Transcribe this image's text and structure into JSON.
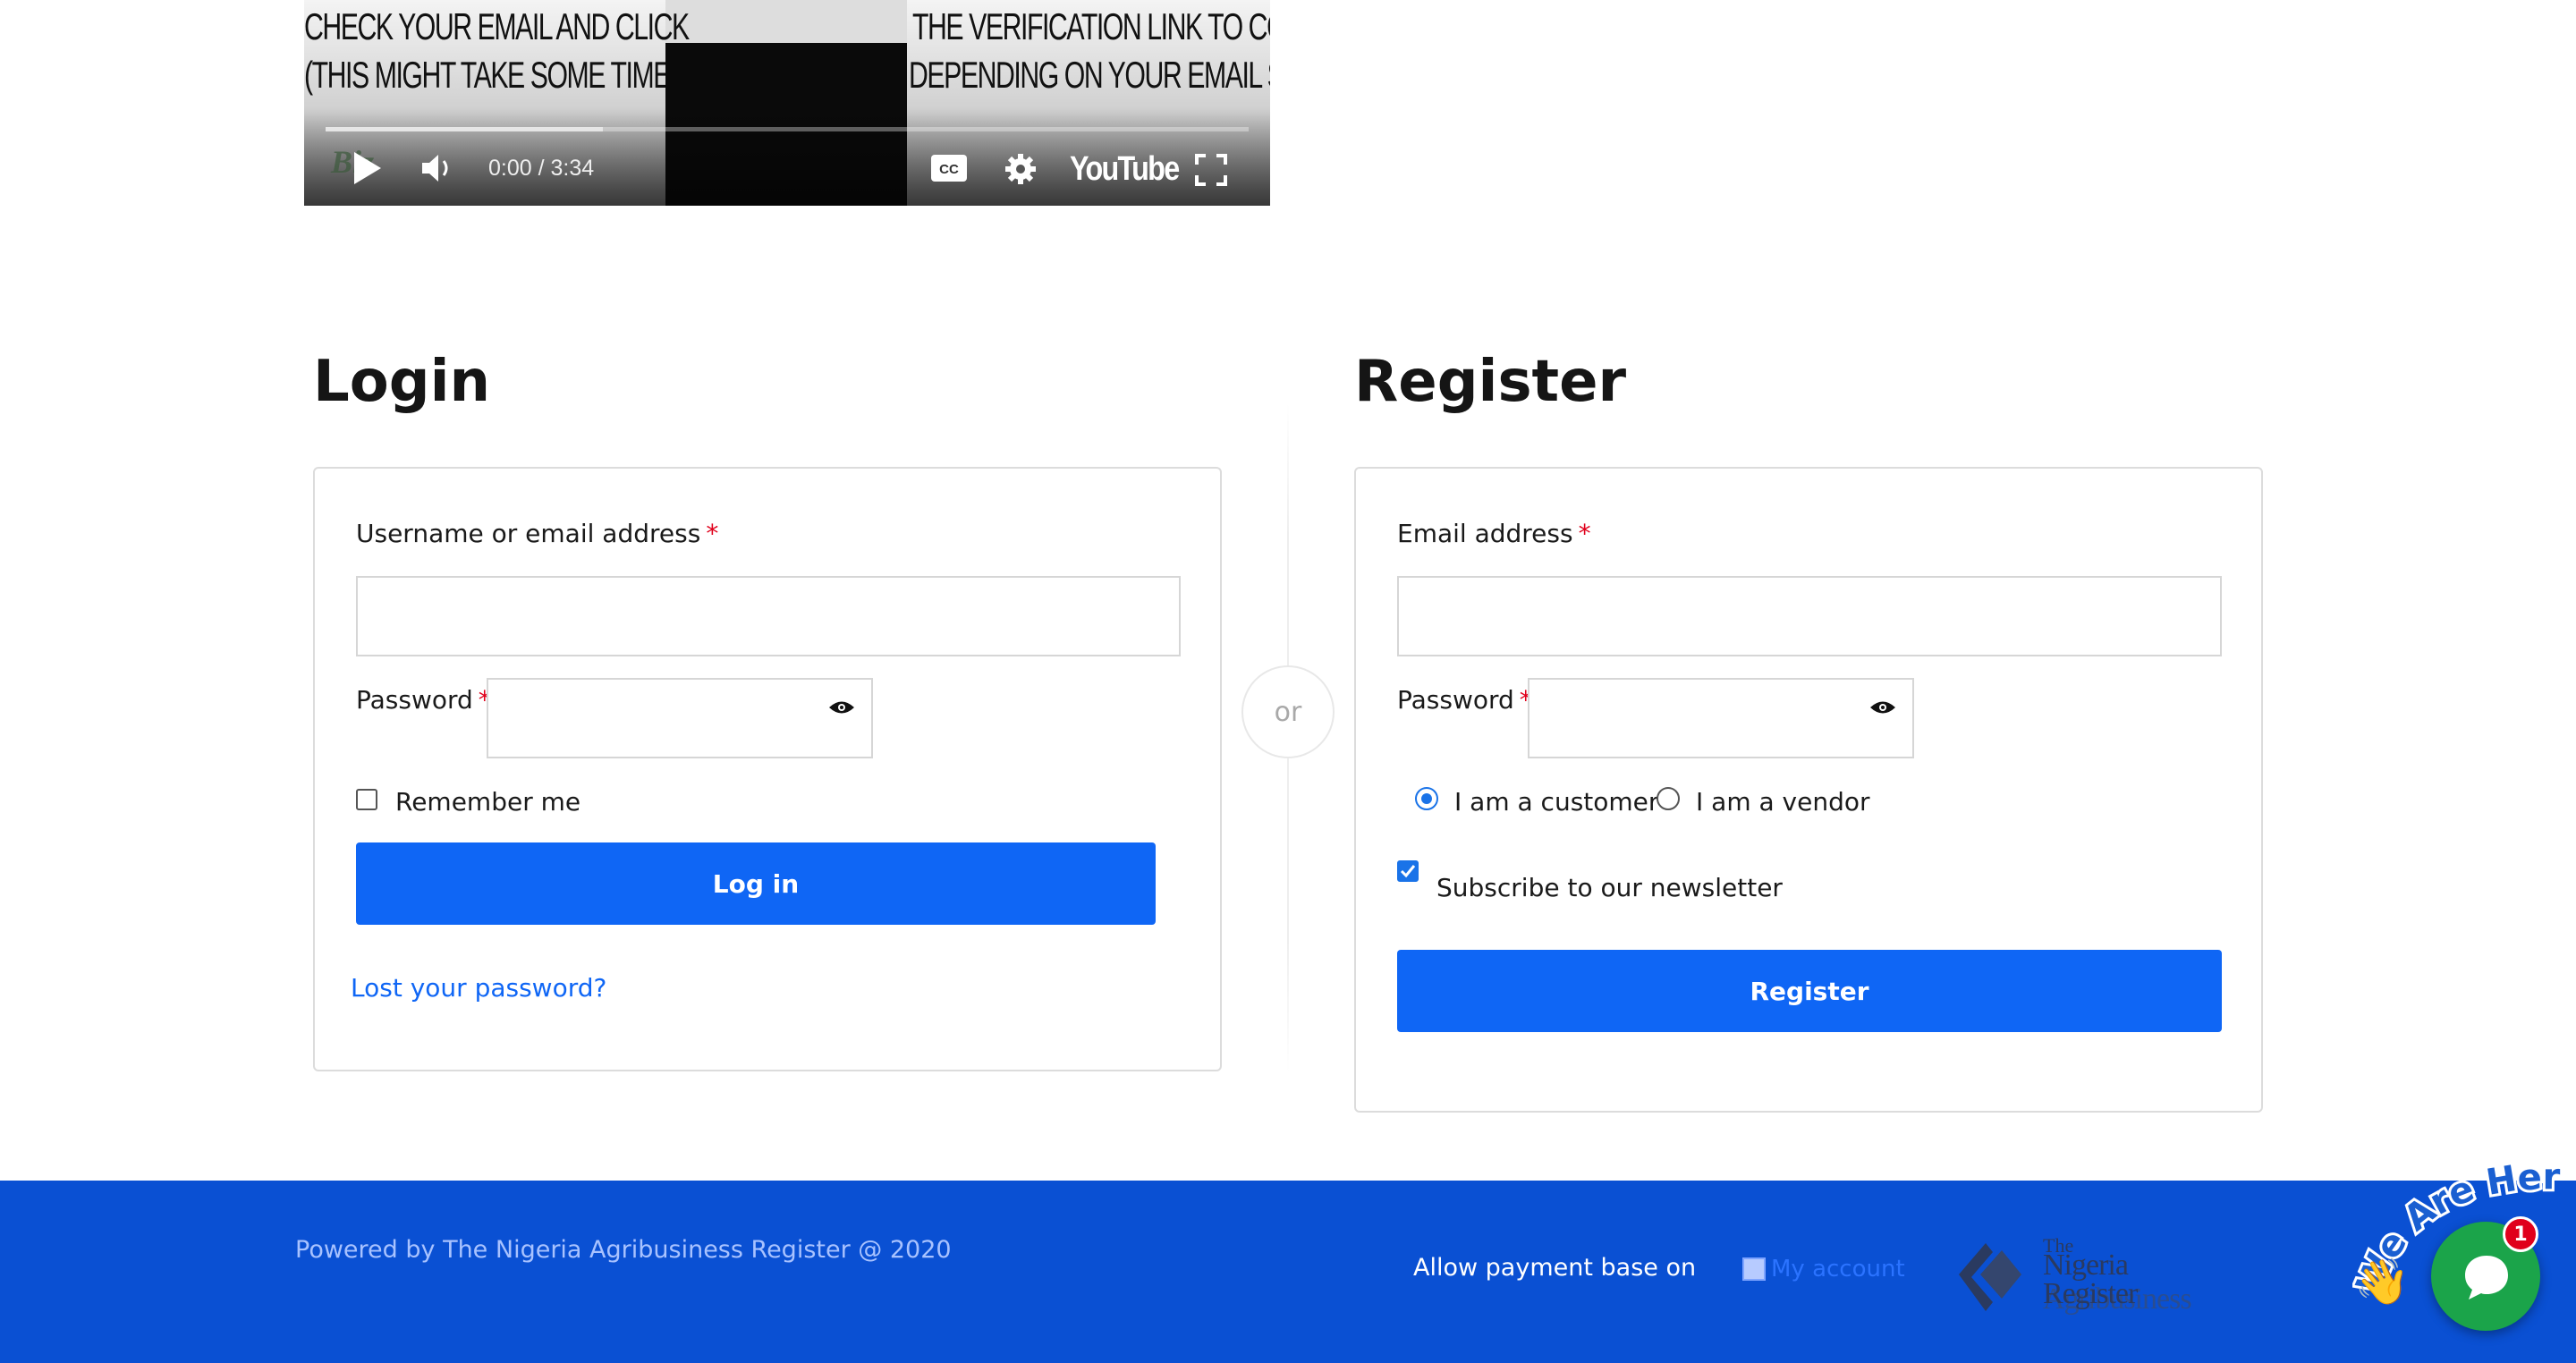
{
  "video": {
    "caption_line1_left": "CHECK YOUR EMAIL AND CLICK",
    "caption_line2_left": "(THIS MIGHT TAKE SOME TIME,",
    "caption_line1_right": "THE VERIFICATION LINK TO CO",
    "caption_line2_right": "DEPENDING ON YOUR EMAIL SE",
    "watermark": "Biz",
    "time": "0:00 / 3:34",
    "brand": "YouTube",
    "progress_loaded": 0.3
  },
  "login": {
    "title": "Login",
    "username_label": "Username or email address",
    "username_value": "",
    "password_label": "Password",
    "password_value": "",
    "required_mark": "*",
    "remember_label": "Remember me",
    "remember_checked": false,
    "submit_label": "Log in",
    "lost_password": "Lost your password?"
  },
  "divider": {
    "text": "or"
  },
  "register": {
    "title": "Register",
    "email_label": "Email address",
    "email_value": "",
    "password_label": "Password",
    "password_value": "",
    "required_mark": "*",
    "role_customer": "I am a customer",
    "role_vendor": "I am a vendor",
    "role_selected": "customer",
    "newsletter_label": "Subscribe to our newsletter",
    "newsletter_checked": true,
    "submit_label": "Register"
  },
  "footer": {
    "powered": "Powered by The Nigeria Agribusiness Register @ 2020",
    "allow_payment": "Allow payment base on",
    "my_account_alt": "My account",
    "logo_the": "The",
    "logo_nigeria": "Nigeria",
    "logo_agribusiness": "Agribusiness",
    "logo_register": "Register"
  },
  "chat": {
    "we_are_here": "We Are Here!",
    "unread_count": "1"
  },
  "colors": {
    "primary_button": "#0f66f5",
    "footer_bg": "#0a50d3",
    "chat_green": "#1ba44a",
    "required_red": "#e0001b"
  }
}
